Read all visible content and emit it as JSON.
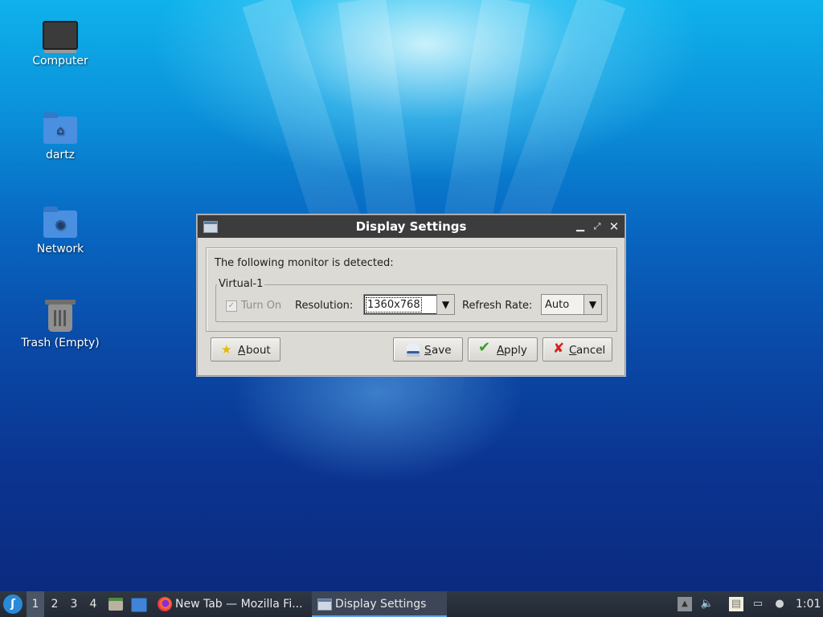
{
  "desktop": {
    "icons": [
      {
        "label": "Computer",
        "icon": "computer-icon"
      },
      {
        "label": "dartz",
        "icon": "home-folder-icon"
      },
      {
        "label": "Network",
        "icon": "network-folder-icon"
      },
      {
        "label": "Trash (Empty)",
        "icon": "trash-icon"
      }
    ]
  },
  "dialog": {
    "title": "Display Settings",
    "detected_text": "The following monitor is detected:",
    "monitor_name": "Virtual-1",
    "turn_on_label": "Turn On",
    "turn_on_checked": true,
    "resolution_label": "Resolution:",
    "resolution_value": "1360x768",
    "refresh_label": "Refresh Rate:",
    "refresh_value": "Auto",
    "buttons": {
      "about": {
        "mnemonic": "A",
        "rest": "bout"
      },
      "save": {
        "mnemonic": "S",
        "rest": "ave"
      },
      "apply": {
        "mnemonic": "A",
        "rest": "pply"
      },
      "cancel": {
        "mnemonic": "C",
        "rest": "ancel"
      }
    }
  },
  "taskbar": {
    "workspaces": [
      "1",
      "2",
      "3",
      "4"
    ],
    "active_workspace": "1",
    "tasks": [
      {
        "label": "New Tab — Mozilla Fi...",
        "icon": "firefox-icon"
      },
      {
        "label": "Display Settings",
        "icon": "window-icon"
      }
    ],
    "clock": "1:01"
  }
}
